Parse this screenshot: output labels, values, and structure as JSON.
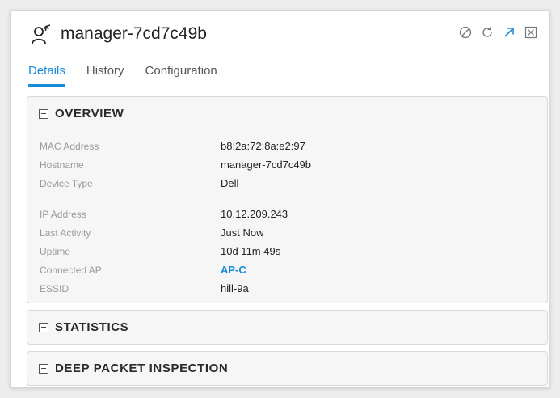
{
  "header": {
    "title": "manager-7cd7c49b",
    "icons": [
      "wireless-client-icon",
      "block-icon",
      "refresh-icon",
      "expand-icon",
      "close-icon"
    ],
    "accent": "#1a8bd8"
  },
  "tabs": [
    {
      "label": "Details",
      "active": true
    },
    {
      "label": "History",
      "active": false
    },
    {
      "label": "Configuration",
      "active": false
    }
  ],
  "overview": {
    "title": "OVERVIEW",
    "expanded": true,
    "group1": [
      {
        "label": "MAC Address",
        "value": "b8:2a:72:8a:e2:97"
      },
      {
        "label": "Hostname",
        "value": "manager-7cd7c49b"
      },
      {
        "label": "Device Type",
        "value": "Dell"
      }
    ],
    "group2": [
      {
        "label": "IP Address",
        "value": "10.12.209.243"
      },
      {
        "label": "Last Activity",
        "value": "Just Now"
      },
      {
        "label": "Uptime",
        "value": "10d 11m 49s"
      },
      {
        "label": "Connected AP",
        "value": "AP-C"
      },
      {
        "label": "ESSID",
        "value": "hill-9a"
      }
    ]
  },
  "statistics": {
    "title": "STATISTICS",
    "expanded": false
  },
  "dpi": {
    "title": "DEEP PACKET INSPECTION",
    "expanded": false
  }
}
